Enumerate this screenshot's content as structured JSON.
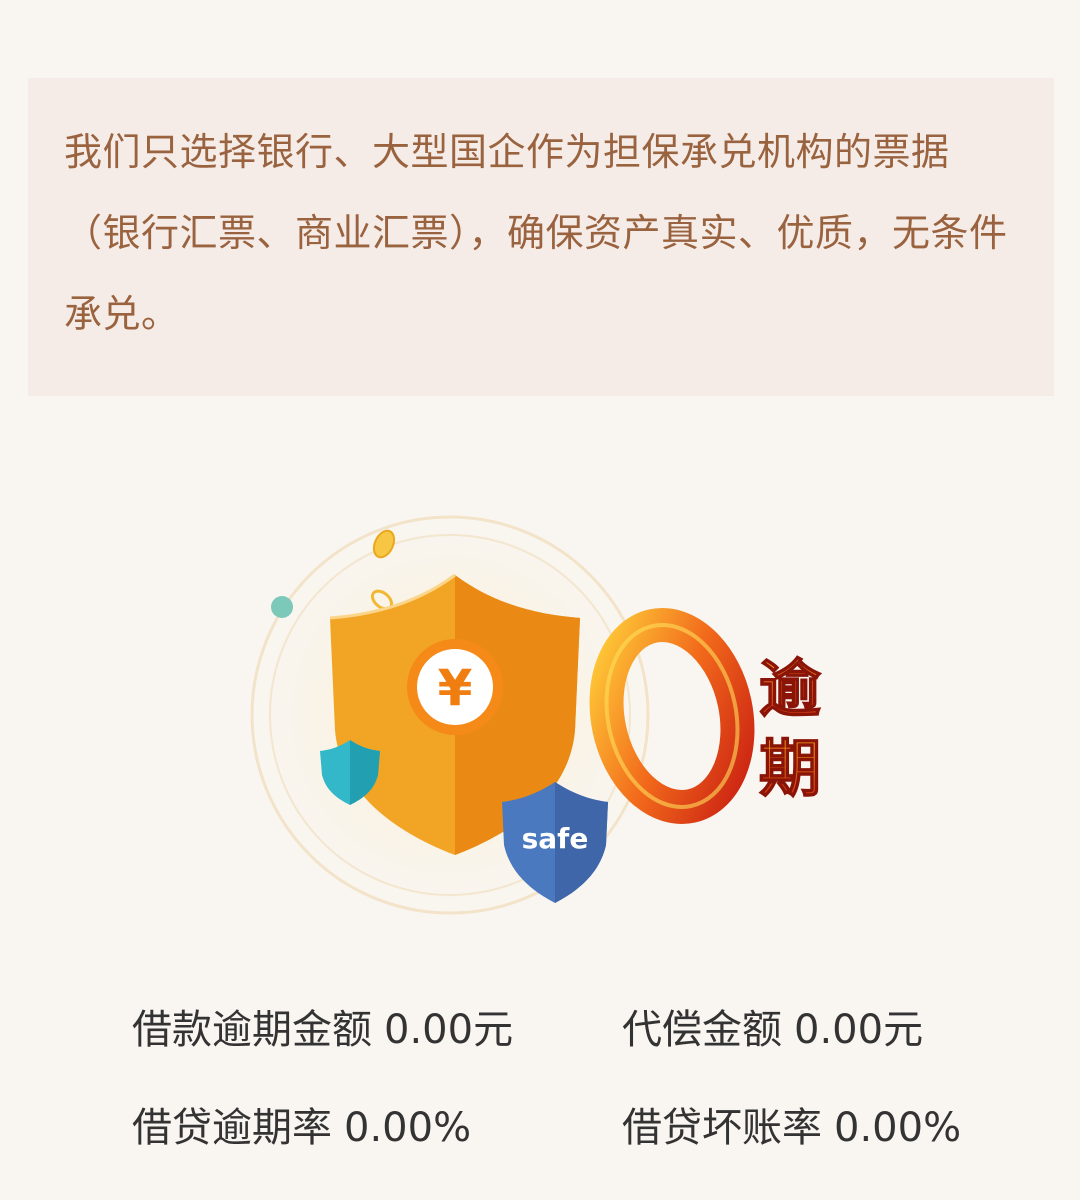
{
  "notice": {
    "text": "我们只选择银行、大型国企作为担保承兑机构的票据（银行汇票、商业汇票），确保资产真实、优质，无条件承兑。"
  },
  "illustration": {
    "currency_symbol": "¥",
    "safe_label": "safe",
    "zero_digit": "0",
    "overdue_line1": "逾",
    "overdue_line2": "期",
    "colors": {
      "shield": "#f2a524",
      "shield_dark": "#ea8a15",
      "small_shield": "#32b8c8",
      "safe_shield": "#4b79c0",
      "zero_ring": "#e8401c",
      "accent_dot": "#7cc8b9"
    },
    "icons": [
      "shield-icon",
      "yen-coin-icon",
      "small-shield-icon",
      "safe-shield-icon",
      "zero-overdue-icon"
    ]
  },
  "stats": [
    {
      "label": "借款逾期金额",
      "value": "0.00元"
    },
    {
      "label": "代偿金额",
      "value": "0.00元"
    },
    {
      "label": "借贷逾期率",
      "value": "0.00%"
    },
    {
      "label": "借贷坏账率",
      "value": "0.00%"
    }
  ]
}
